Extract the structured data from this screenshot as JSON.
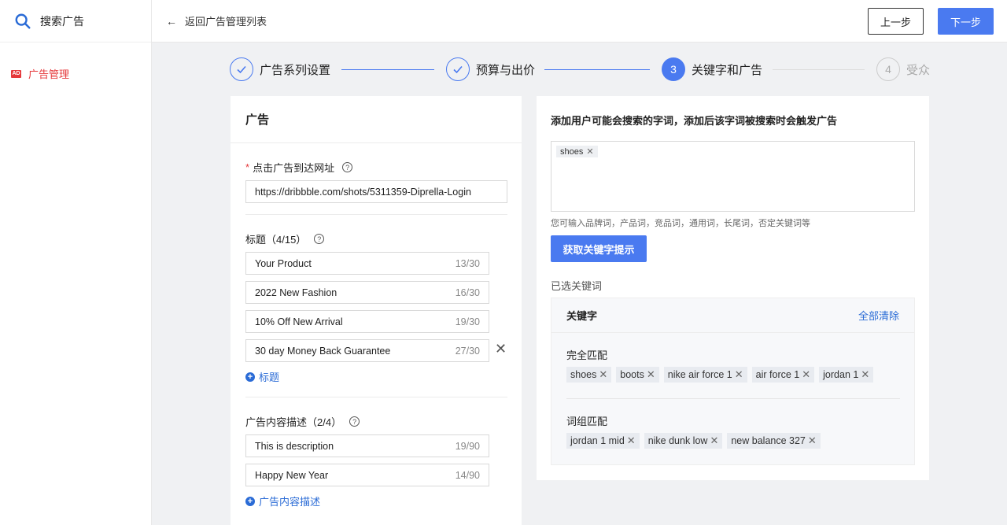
{
  "sidebar": {
    "brand_title": "搜索广告",
    "nav": {
      "icon_text": "AD",
      "label": "广告管理"
    }
  },
  "topbar": {
    "back_label": "返回广告管理列表",
    "prev_label": "上一步",
    "next_label": "下一步"
  },
  "steps": [
    {
      "number": "",
      "label": "广告系列设置",
      "status": "done"
    },
    {
      "number": "",
      "label": "预算与出价",
      "status": "done"
    },
    {
      "number": "3",
      "label": "关键字和广告",
      "status": "active"
    },
    {
      "number": "4",
      "label": "受众",
      "status": "todo"
    }
  ],
  "ad_card": {
    "title": "广告",
    "url_label": "点击广告到达网址",
    "required_mark": "*",
    "url_value": "https://dribbble.com/shots/5311359-Diprella-Login",
    "headlines_label": "标题（4/15）",
    "headlines": [
      {
        "text": "Your Product",
        "count": "13/30"
      },
      {
        "text": "2022 New Fashion",
        "count": "16/30"
      },
      {
        "text": "10% Off New Arrival",
        "count": "19/30"
      },
      {
        "text": "30 day Money Back Guarantee",
        "count": "27/30"
      }
    ],
    "add_headline_label": "标题",
    "desc_label": "广告内容描述（2/4）",
    "descriptions": [
      {
        "text": "This is description",
        "count": "19/90"
      },
      {
        "text": "Happy New Year",
        "count": "14/90"
      }
    ],
    "add_desc_label": "广告内容描述"
  },
  "keyword_card": {
    "title": "添加用户可能会搜索的字词，添加后该字词被搜索时会触发广告",
    "input_tag": "shoes",
    "hint": "您可输入品牌词，产品词，竞品词，通用词，长尾词，否定关键词等",
    "suggest_button": "获取关键字提示",
    "selected_label": "已选关键词",
    "box_title": "关键字",
    "clear_all": "全部清除",
    "exact_title": "完全匹配",
    "exact": [
      "shoes",
      "boots",
      "nike air force 1",
      "air force 1",
      "jordan 1"
    ],
    "phrase_title": "词组匹配",
    "phrase": [
      "jordan 1 mid",
      "nike dunk low",
      "new balance 327"
    ]
  },
  "colors": {
    "accent": "#4a7af0",
    "danger": "#e5383b",
    "link": "#2a6bd6"
  }
}
